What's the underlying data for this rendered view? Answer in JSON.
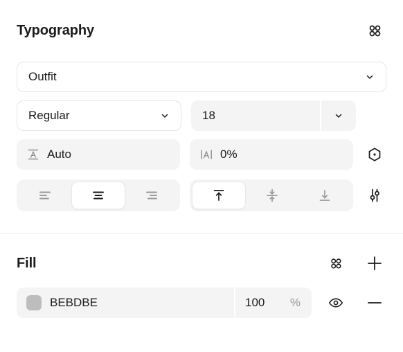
{
  "typography": {
    "title": "Typography",
    "settings_icon": "grid-dots-icon",
    "font_family": {
      "value": "Outfit",
      "chevron": "chevron-down-icon"
    },
    "font_weight": {
      "value": "Regular",
      "chevron": "chevron-down-icon"
    },
    "font_size": {
      "value": "18",
      "chevron": "chevron-down-icon"
    },
    "line_height": {
      "icon": "line-height-icon",
      "value": "Auto"
    },
    "letter_spacing": {
      "icon": "letter-spacing-icon",
      "value": "0%"
    },
    "decoration_icon": "hexagon-dot-icon",
    "align_horizontal": {
      "options": [
        "align-left",
        "align-center",
        "align-right"
      ],
      "selected": "align-center"
    },
    "align_vertical": {
      "options": [
        "align-top",
        "align-middle",
        "align-bottom"
      ],
      "selected": "align-top"
    },
    "advanced_icon": "sliders-icon"
  },
  "fill": {
    "title": "Fill",
    "settings_icon": "grid-dots-icon",
    "add_icon": "plus-icon",
    "items": [
      {
        "color": "#BEBDBE",
        "hex": "BEBDBE",
        "opacity": "100",
        "opacity_unit": "%",
        "visibility_icon": "eye-icon",
        "remove_icon": "minus-icon"
      }
    ]
  },
  "colors": {
    "text_primary": "#1a1a1a",
    "text_muted": "#9a9a9a",
    "field_gray": "#f4f4f4",
    "border": "#e6e6e6",
    "divider": "#ececec"
  }
}
